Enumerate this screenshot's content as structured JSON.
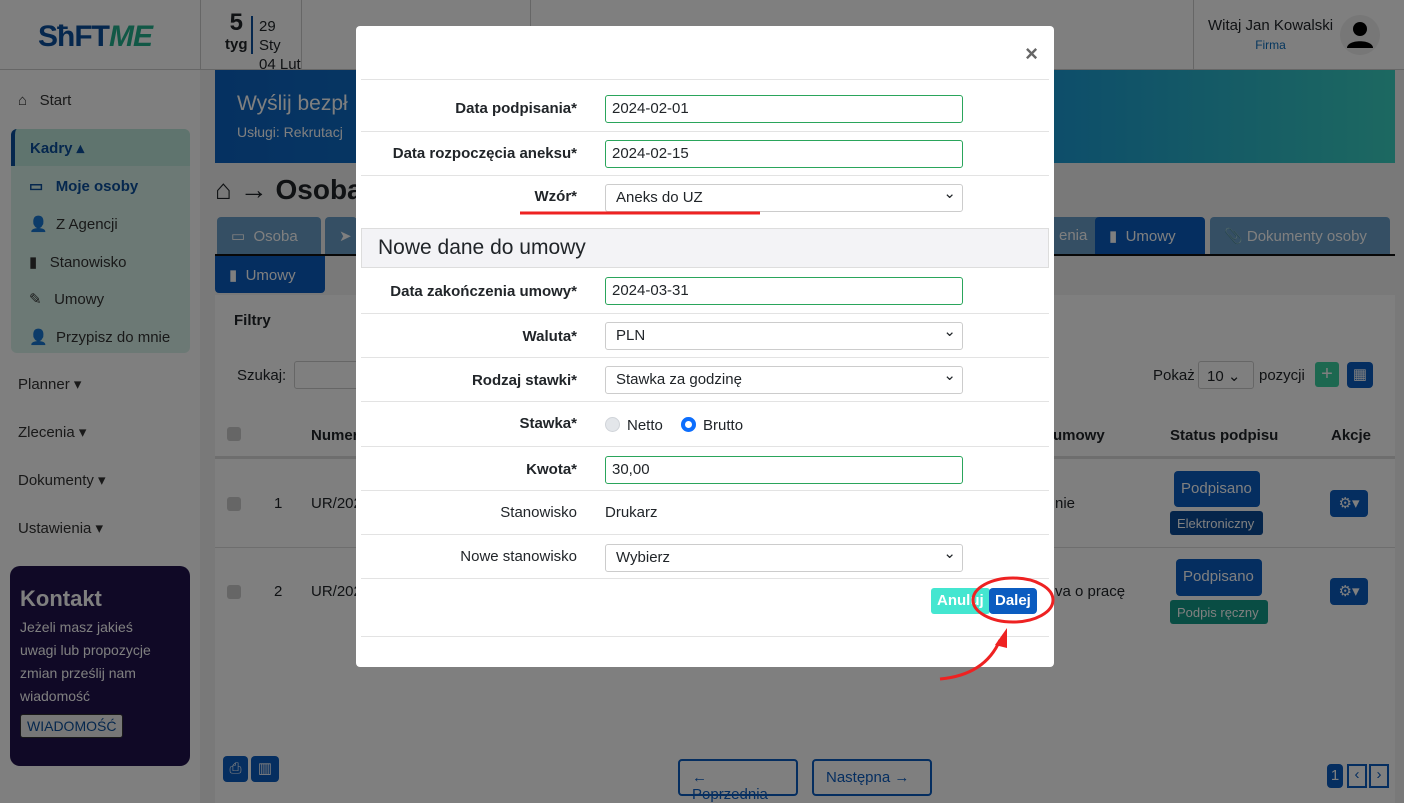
{
  "header": {
    "logo_a": "SħFT",
    "logo_b": "ME",
    "week_num": "5",
    "week_label": "tyg",
    "date_from": "29 Sty",
    "date_to": "04 Lut",
    "greeting": "Witaj Jan Kowalski",
    "company": "Firma"
  },
  "sidebar": {
    "start": "Start",
    "kadry": "Kadry ▴",
    "items": [
      "Moje osoby",
      "Z Agencji",
      "Stanowisko",
      "Umowy",
      "Przypisz do mnie"
    ],
    "menus": [
      "Planner ▾",
      "Zlecenia ▾",
      "Dokumenty ▾",
      "Ustawienia ▾"
    ],
    "contact": {
      "title": "Kontakt",
      "text": "Jeżeli masz jakieś uwagi lub propozycje zmian prześlij nam wiadomość",
      "button": "WIADOMOŚĆ"
    }
  },
  "main": {
    "banner_title": "Wyślij bezpł",
    "banner_sub": "Usługi: Rekrutacj",
    "page_title": "Osoba",
    "tabs": [
      "Osoba",
      "enia",
      "Umowy",
      "Dokumenty osoby"
    ],
    "subtab": "Umowy",
    "filters": "Filtry",
    "search_label": "Szukaj:",
    "show_label": "Pokaż",
    "show_value": "10",
    "show_suffix": "pozycji",
    "columns": [
      "Numer",
      "umowy",
      "Status podpisu",
      "Akcje"
    ],
    "rows": [
      {
        "n": "1",
        "num": "UR/202",
        "type": "nie",
        "status": "Podpisano",
        "mode": "Elektroniczny"
      },
      {
        "n": "2",
        "num": "UR/202",
        "type": "va o pracę",
        "status": "Podpisano",
        "mode": "Podpis ręczny"
      }
    ],
    "prev": "← Poprzednia",
    "next": "Następna →",
    "page": "1"
  },
  "modal": {
    "close": "×",
    "fields": [
      {
        "label": "Data podpisania*",
        "value": "2024-02-01"
      },
      {
        "label": "Data rozpoczęcia aneksu*",
        "value": "2024-02-15"
      },
      {
        "label": "Wzór*",
        "value": "Aneks do UZ"
      }
    ],
    "section": "Nowe dane do umowy",
    "fields2": [
      {
        "label": "Data zakończenia umowy*",
        "value": "2024-03-31"
      },
      {
        "label": "Waluta*",
        "value": "PLN"
      },
      {
        "label": "Rodzaj stawki*",
        "value": "Stawka za godzinę"
      },
      {
        "label": "Stawka*",
        "opt1": "Netto",
        "opt2": "Brutto",
        "selected": "Brutto"
      },
      {
        "label": "Kwota*",
        "value": "30,00"
      },
      {
        "label": "Stanowisko",
        "value": "Drukarz"
      },
      {
        "label": "Nowe stanowisko",
        "value": "Wybierz"
      }
    ],
    "cancel": "Anuluj",
    "next": "Dalej"
  },
  "colors": {
    "primary": "#0b5cc0",
    "accent": "#22b08c",
    "annotation": "#ee2222"
  }
}
